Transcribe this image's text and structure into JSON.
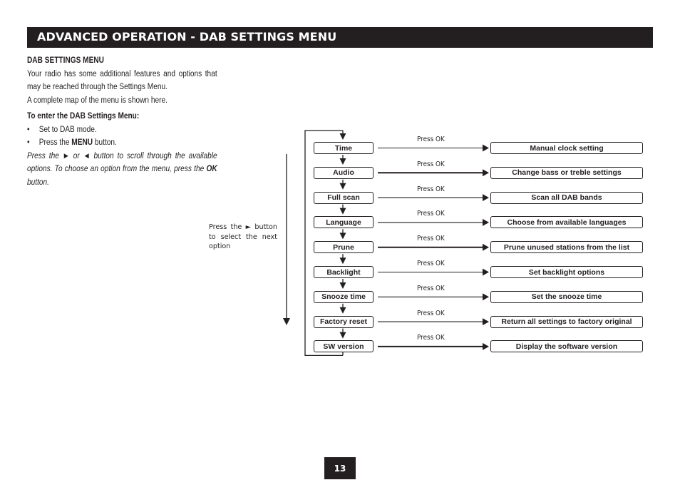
{
  "header": {
    "title": "ADVANCED OPERATION - DAB SETTINGS MENU"
  },
  "intro": {
    "section_title": "DAB SETTINGS MENU",
    "paragraph1": "Your radio has some additional features and options that may be reached through the Settings Menu.",
    "paragraph2": "A complete map of the menu is shown here.",
    "enter_title": "To enter the DAB Settings Menu:",
    "bullets": [
      {
        "dot": "•",
        "text": "Set to DAB mode."
      },
      {
        "dot": "•",
        "prefix": "Press the ",
        "bold": "MENU",
        "suffix": " button."
      }
    ],
    "scroll_para": {
      "part1": "Press the ",
      "right_arrow": "►",
      "part2": " or ",
      "left_arrow": "◄",
      "part3": " button to scroll through the available options. To choose an option from the menu, press the ",
      "ok": "OK",
      "part4": " button."
    }
  },
  "side_note": {
    "text1": "Press the ",
    "arrow": "►",
    "text2": " button to select the next option"
  },
  "menu_map": {
    "arrow_label": "Press OK",
    "items": [
      {
        "label": "Time",
        "result": "Manual clock setting"
      },
      {
        "label": "Audio",
        "result": "Change bass or treble settings"
      },
      {
        "label": "Full scan",
        "result": "Scan all DAB bands"
      },
      {
        "label": "Language",
        "result": "Choose from available languages"
      },
      {
        "label": "Prune",
        "result": "Prune unused stations from the list"
      },
      {
        "label": "Backlight",
        "result": "Set backlight options"
      },
      {
        "label": "Snooze time",
        "result": "Set the snooze time"
      },
      {
        "label": "Factory reset",
        "result": "Return all settings to factory original"
      },
      {
        "label": "SW version",
        "result": "Display the software version"
      }
    ]
  },
  "footer": {
    "page_number": "13"
  },
  "colors": {
    "ink": "#231f20",
    "background": "#ffffff"
  }
}
